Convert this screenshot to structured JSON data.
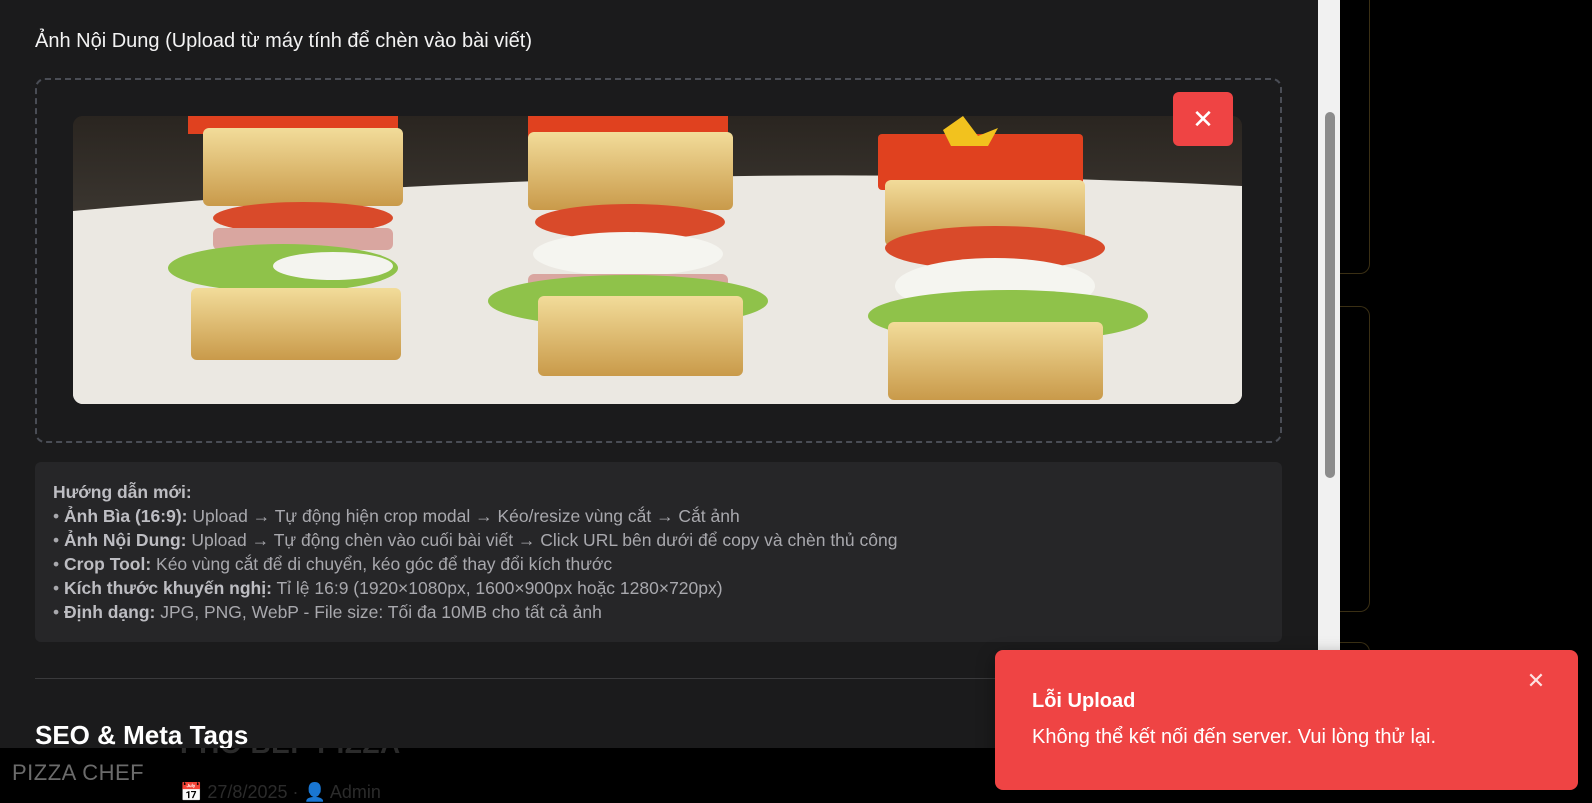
{
  "background": {
    "title": "PHỐ BẾP PIZZA",
    "meta": "📅 27/8/2025 · 👤 Admin",
    "brand": "PIZZA CHEF"
  },
  "modal": {
    "content_images": {
      "label": "Ảnh Nội Dung (Upload từ máy tính để chèn vào bài viết)",
      "remove_icon": "close-icon",
      "remove_symbol": "✕"
    },
    "guide": {
      "heading": "Hướng dẫn mới:",
      "items": [
        {
          "bullet": "• ",
          "key": "Ảnh Bìa (16:9):",
          "text": " Upload → Tự động hiện crop modal → Kéo/resize vùng cắt → Cắt ảnh"
        },
        {
          "bullet": "• ",
          "key": "Ảnh Nội Dung:",
          "text": " Upload → Tự động chèn vào cuối bài viết → Click URL bên dưới để copy và chèn thủ công"
        },
        {
          "bullet": "• ",
          "key": "Crop Tool:",
          "text": " Kéo vùng cắt để di chuyển, kéo góc để thay đổi kích thước"
        },
        {
          "bullet": "• ",
          "key": "Kích thước khuyến nghị:",
          "text": " Tỉ lệ 16:9 (1920×1080px, 1600×900px hoặc 1280×720px)"
        },
        {
          "bullet": "• ",
          "key": "Định dạng:",
          "text": " JPG, PNG, WebP - File size: Tối đa 10MB cho tất cả ảnh"
        }
      ]
    },
    "seo_heading": "SEO & Meta Tags"
  },
  "toast": {
    "title": "Lỗi Upload",
    "message": "Không thể kết nối đến server. Vui lòng thử lại.",
    "close_symbol": "✕"
  },
  "colors": {
    "modal_bg": "#1b1b1c",
    "toast_bg": "#ef4444",
    "remove_button": "#ef4444"
  }
}
